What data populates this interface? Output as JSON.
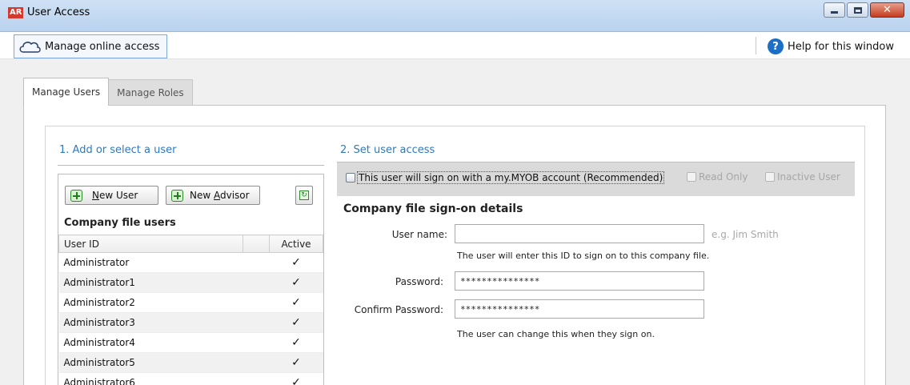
{
  "window": {
    "app_badge": "AR",
    "title": "User Access"
  },
  "toolbar": {
    "manage_online_label": "Manage online access",
    "help_label": "Help for this window"
  },
  "tabs": [
    {
      "label": "Manage Users",
      "active": true
    },
    {
      "label": "Manage Roles",
      "active": false
    }
  ],
  "left": {
    "heading": "1. Add or select a user",
    "new_user_label": "New User",
    "new_user_mnemonic": "N",
    "new_user_rest": "ew User",
    "new_advisor_prefix": "New ",
    "new_advisor_mnemonic": "A",
    "new_advisor_rest": "dvisor",
    "users_title": "Company file users",
    "columns": [
      "User ID",
      "",
      "Active"
    ],
    "users": [
      {
        "id": "Administrator",
        "active": "✓"
      },
      {
        "id": "Administrator1",
        "active": "✓"
      },
      {
        "id": "Administrator2",
        "active": "✓"
      },
      {
        "id": "Administrator3",
        "active": "✓"
      },
      {
        "id": "Administrator4",
        "active": "✓"
      },
      {
        "id": "Administrator5",
        "active": "✓"
      },
      {
        "id": "Administrator6",
        "active": "✓"
      }
    ]
  },
  "right": {
    "heading": "2. Set user access",
    "mymyob_label": "This user will sign on with a my.MYOB account (Recommended)",
    "read_only_label": "Read Only",
    "inactive_label": "Inactive User",
    "signon_title": "Company file sign-on details",
    "username_label": "User name:",
    "username_value": "",
    "username_hint": "e.g. Jim Smith",
    "username_note": "The user will enter this ID to sign on to this company file.",
    "password_label": "Password:",
    "password_value": "***************",
    "confirm_label": "Confirm Password:",
    "confirm_value": "***************",
    "password_note": "The user can change this when they sign on."
  }
}
